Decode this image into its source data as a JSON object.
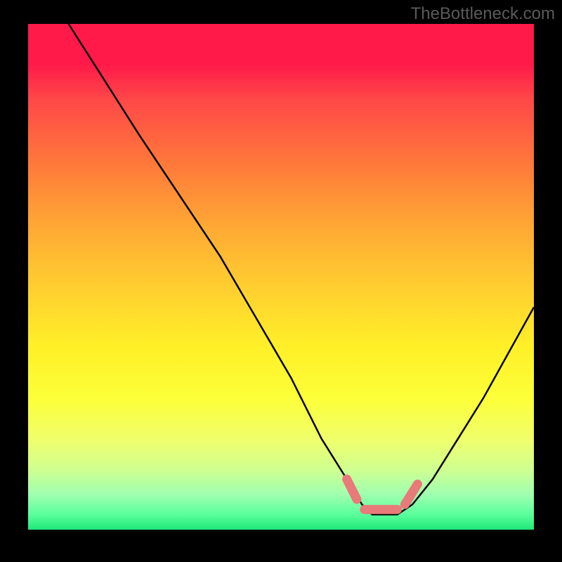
{
  "watermark": "TheBottleneck.com",
  "chart_data": {
    "type": "line",
    "title": "",
    "xlabel": "",
    "ylabel": "",
    "xlim": [
      0,
      100
    ],
    "ylim": [
      0,
      100
    ],
    "x": [
      8,
      15,
      22,
      30,
      38,
      45,
      52,
      58,
      63,
      66,
      68,
      70,
      73,
      76,
      80,
      85,
      90,
      95,
      100
    ],
    "values": [
      100,
      89,
      78,
      66,
      54,
      42,
      30,
      18,
      10,
      5,
      3,
      3,
      3,
      5,
      10,
      18,
      26,
      35,
      44
    ],
    "highlight_region": {
      "x_start": 63,
      "x_end": 76,
      "color": "#e87a7a",
      "description": "optimal zone markers near curve minimum"
    },
    "gradient_colors": {
      "top": "#ff1a4a",
      "mid": "#ffd030",
      "bottom": "#20e878"
    }
  }
}
